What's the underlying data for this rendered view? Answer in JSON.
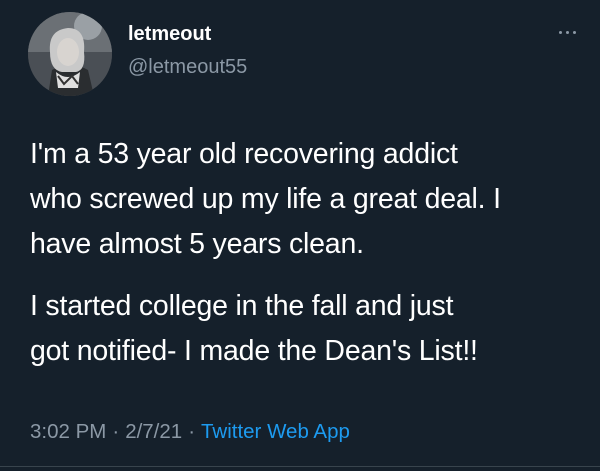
{
  "author": {
    "display_name": "letmeout",
    "handle": "@letmeout55",
    "avatar_icon": "profile-photo"
  },
  "tweet": {
    "paragraph_1": "I'm a 53 year old recovering addict\nwho screwed up my life a great deal. I\nhave almost 5 years clean.",
    "paragraph_2": "I started college in the fall and just\ngot notified- I made the Dean's List!!"
  },
  "meta": {
    "time": "3:02 PM",
    "separator": "·",
    "date": "2/7/21",
    "source": "Twitter Web App"
  },
  "more_icon": "ellipsis-icon",
  "colors": {
    "background": "#15202b",
    "text_primary": "#ffffff",
    "text_secondary": "#8b98a5",
    "link": "#1d9bf0"
  }
}
